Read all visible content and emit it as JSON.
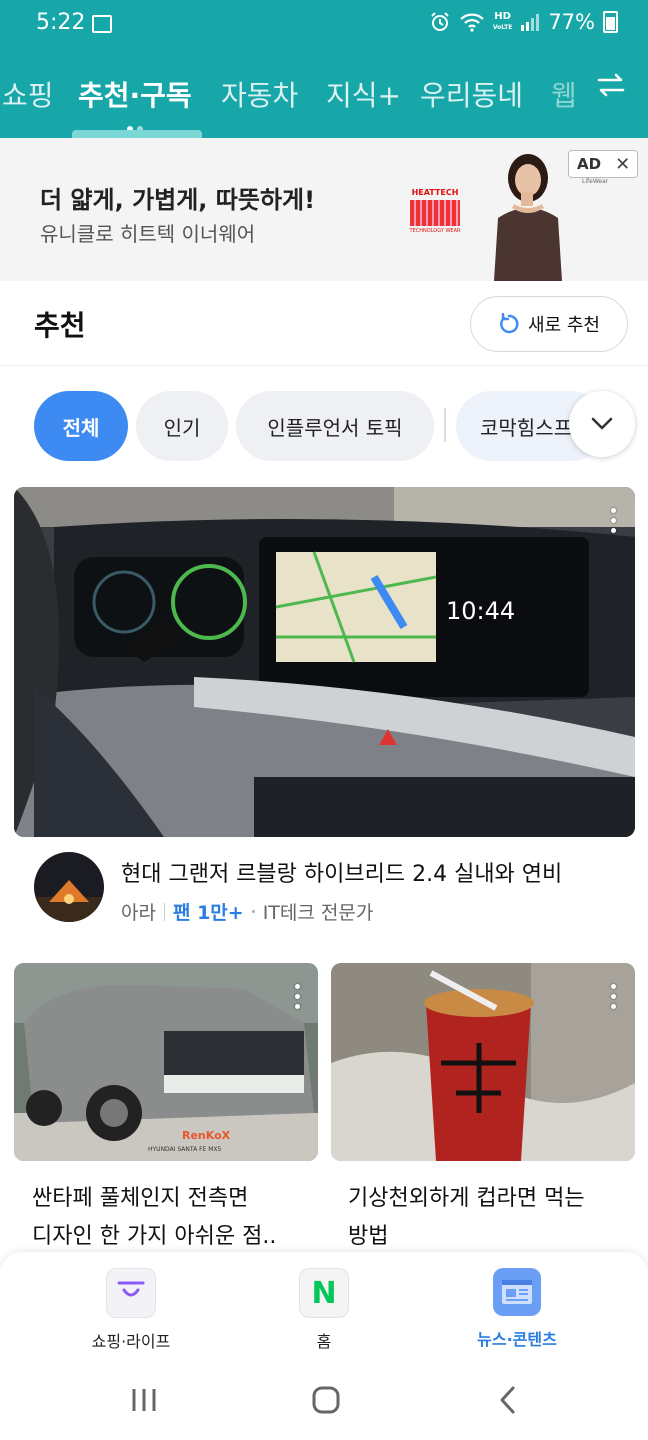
{
  "status": {
    "time": "5:22",
    "hd": "HD",
    "voice": "VoLTE",
    "battery": "77%"
  },
  "tabs": [
    {
      "label": "쇼핑"
    },
    {
      "label": "추천·구독"
    },
    {
      "label": "자동차"
    },
    {
      "label": "지식+"
    },
    {
      "label": "우리동네"
    },
    {
      "label": "웹"
    }
  ],
  "ad": {
    "headline": "더 얇게, 가볍게, 따뜻하게!",
    "subtitle": "유니클로 히트텍 이너웨어",
    "badge": "AD",
    "close": "✕",
    "heattech_label": "HEATTECH",
    "heattech_tag": "TECHNOLOGY WEAR",
    "brand_small": "LifeWear"
  },
  "section": {
    "title": "추천",
    "refresh_label": "새로 추천"
  },
  "chips": [
    {
      "label": "전체"
    },
    {
      "label": "인기"
    },
    {
      "label": "인플루언서 토픽"
    },
    {
      "label": "코막힘스프"
    }
  ],
  "main_card": {
    "title": "현대 그랜저 르블랑 하이브리드 2.4 실내와 연비",
    "author": "아라",
    "fans": "팬 1만+",
    "category": "IT테크 전문가",
    "clock_text": "10:44"
  },
  "cards": [
    {
      "title_line1": "싼타페 풀체인지 전측면",
      "title_line2": "디자인 한 가지 아쉬운 점..",
      "car_plate": "HYUNDAI SANTA FE MX5",
      "brand": "RenKoX"
    },
    {
      "title_line1": "기상천외하게 컵라면 먹는",
      "title_line2": "방법"
    }
  ],
  "bottom_nav": [
    {
      "label": "쇼핑·라이프",
      "icon": "shopping-bag-icon"
    },
    {
      "label": "홈",
      "icon": "naver-n-icon",
      "glyph": "N"
    },
    {
      "label": "뉴스·콘텐츠",
      "icon": "news-icon"
    }
  ],
  "colors": {
    "header": "#17a7a8",
    "accent": "#3d8bf2",
    "link": "#2a7de1",
    "naver_green": "#03c75a"
  }
}
